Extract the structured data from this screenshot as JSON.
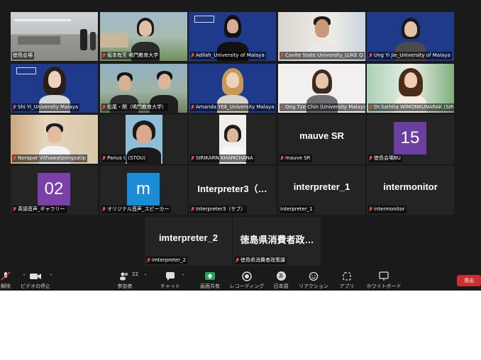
{
  "participants": [
    {
      "name": "徳島会場",
      "active": true,
      "muted": false
    },
    {
      "name": "坂本有芳 鳴門教育大学",
      "muted": true
    },
    {
      "name": "Adilah_University of Malaya",
      "muted": true
    },
    {
      "name": "Cavite State University_LUKE Q",
      "muted": true
    },
    {
      "name": "Ung Yi Jie_University of Malaya",
      "muted": true
    },
    {
      "name": "Shi Yi_University Malaya",
      "muted": true
    },
    {
      "name": "松尾・関（鳴門教育大学）",
      "muted": true
    },
    {
      "name": "Amanda YEE_University Malaya",
      "muted": true
    },
    {
      "name": "Ong Tze Chin (University Malaya)",
      "muted": true
    },
    {
      "name": "Dr.Sathita WIMONKUNARAK (SIRINDHORN)",
      "muted": true
    },
    {
      "name": "Norapat Vithawatpongsatip",
      "muted": true
    },
    {
      "name": "Panus I. (STOU)",
      "muted": true
    },
    {
      "name": "SIRIKARN KHAMCHANA",
      "muted": true
    },
    {
      "name": "mauve SR",
      "muted": true,
      "display": "mauve SR"
    },
    {
      "name": "徳島会場BU",
      "muted": true,
      "avatar": "15",
      "avatar_color": "#6b3fa0"
    },
    {
      "name": "英語音声_ギャラリー",
      "muted": true,
      "avatar": "02",
      "avatar_color": "#7b3fa8"
    },
    {
      "name": "オリジナル音声_スピーカー",
      "muted": true,
      "avatar": "m",
      "avatar_color": "#1b8cd6"
    },
    {
      "name": "Interpreter3（サブ）",
      "muted": true,
      "display": "Interpreter3（…"
    },
    {
      "name": "interpreter_1",
      "muted": false,
      "display": "interpreter_1"
    },
    {
      "name": "intermonitor",
      "muted": true,
      "display": "intermonitor"
    },
    {
      "name": "imterpreter_2",
      "muted": true,
      "display": "imterpreter_2"
    },
    {
      "name": "徳島県消費者政策課",
      "muted": true,
      "display": "徳島県消費者政…"
    }
  ],
  "toolbar": {
    "mute_label": "解除",
    "video_label": "ビデオの停止",
    "participants_label": "参加者",
    "participants_count": "22",
    "chat_label": "チャット",
    "share_label": "画面共有",
    "record_label": "レコーディング",
    "language_label": "日本語",
    "reactions_label": "リアクション",
    "apps_label": "アプリ",
    "whiteboard_label": "ホワイトボード",
    "leave_label": "退出",
    "language_icon_text": "あ"
  },
  "colors": {
    "share_green": "#1fa755",
    "leave_red": "#cc2f2f",
    "active_border": "#e3d84c",
    "um_blue": "#1f3a8a"
  }
}
